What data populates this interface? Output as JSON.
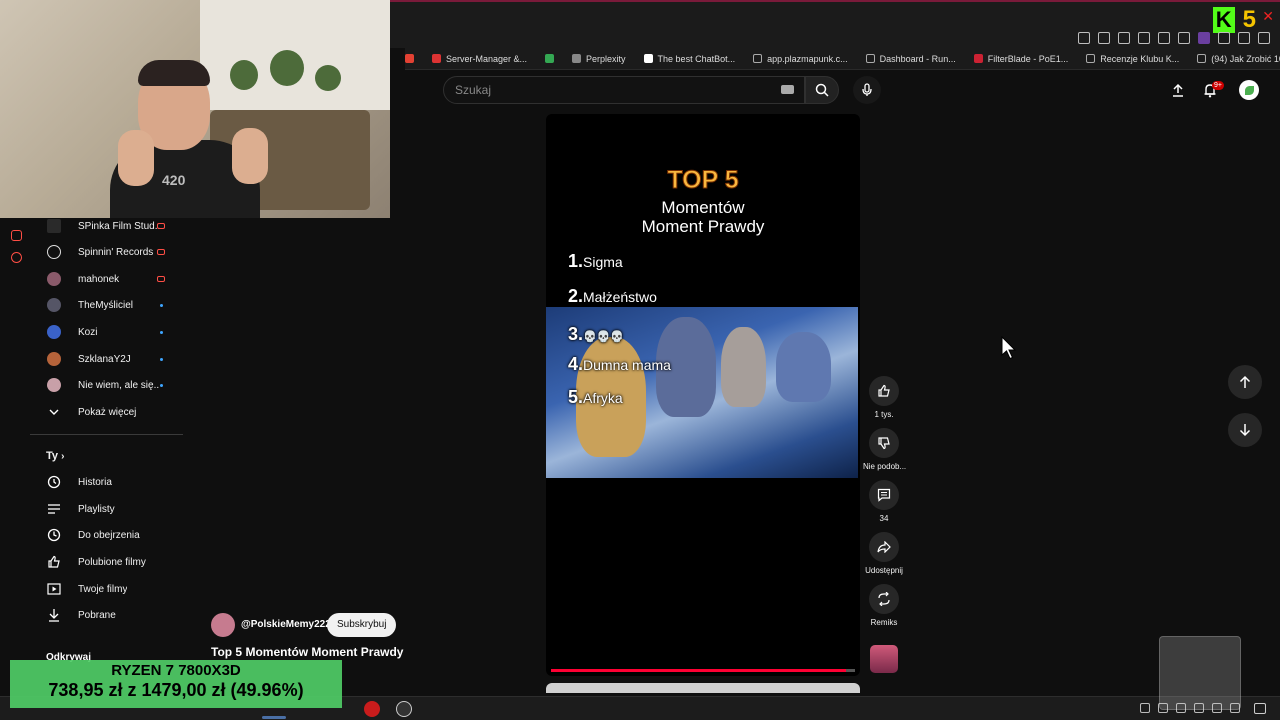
{
  "browser": {
    "bookmarks": [
      "Server-Manager &...",
      "Perplexity",
      "The best ChatBot...",
      "app.plazmapunk.c...",
      "Dashboard - Run...",
      "FilterBlade - PoE1...",
      "Recenzje Klubu K...",
      "(94) Jak Zrobić 10..."
    ],
    "kick_number": "5",
    "kick_letter": "K"
  },
  "header": {
    "search_placeholder": "Szukaj",
    "notif_badge": "9+"
  },
  "sidebar": {
    "subscriptions": [
      {
        "label": "SPinka Film Stud...",
        "indicator": "live"
      },
      {
        "label": "Spinnin' Records",
        "indicator": "live"
      },
      {
        "label": "mahonek",
        "indicator": "live"
      },
      {
        "label": "TheMyśliciel",
        "indicator": "dot"
      },
      {
        "label": "Kozi",
        "indicator": "dot"
      },
      {
        "label": "SzklanaY2J",
        "indicator": "dot"
      },
      {
        "label": "Nie wiem, ale się...",
        "indicator": "dot"
      }
    ],
    "show_more": "Pokaż więcej",
    "you_section": "Ty",
    "you_items": [
      "Historia",
      "Playlisty",
      "Do obejrzenia",
      "Polubione filmy",
      "Twoje filmy",
      "Pobrane"
    ],
    "explore": "Odkrywaj"
  },
  "short": {
    "heading": "TOP 5",
    "subtitle_line1": "Momentów",
    "subtitle_line2": "Moment Prawdy",
    "list": [
      {
        "num": "1.",
        "text": "Sigma"
      },
      {
        "num": "2.",
        "text": "Małżeństwo"
      },
      {
        "num": "3.",
        "text": "💀💀💀"
      },
      {
        "num": "4.",
        "text": "Dumna mama"
      },
      {
        "num": "5.",
        "text": "Afryka"
      }
    ],
    "progress": 0.97
  },
  "actions": {
    "likes": "1 tys.",
    "dislike": "Nie podob...",
    "comments": "34",
    "share": "Udostępnij",
    "remix": "Remiks"
  },
  "channel": {
    "handle": "@PolskieMemy222",
    "subscribe": "Subskrybuj",
    "title": "Top 5 Momentów Moment Prawdy"
  },
  "overlay_price": {
    "line1": "RYZEN 7 7800X3D",
    "line2": "738,95 zł z 1479,00 zł (49.96%)"
  },
  "colors": {
    "background": "#0f0f0f",
    "accent_red": "#ff0033",
    "price_green": "#4fcc66",
    "heading_orange": "#f9b73f"
  }
}
